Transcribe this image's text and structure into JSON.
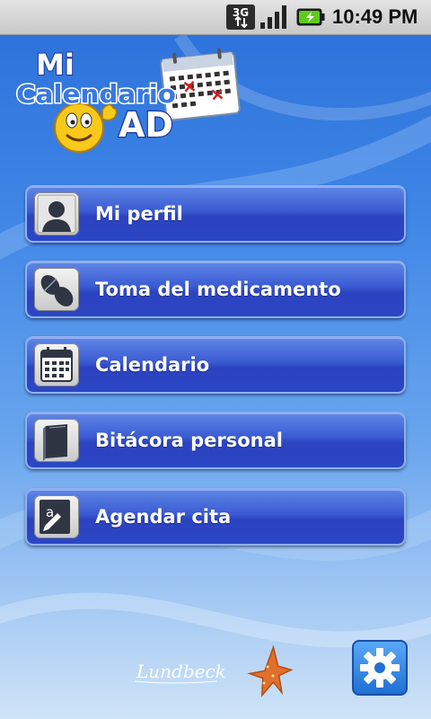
{
  "status_bar": {
    "network_label": "3G",
    "time": "10:49 PM",
    "icons": [
      "3g-data-icon",
      "signal-strength-icon",
      "battery-charging-icon"
    ]
  },
  "logo": {
    "line1": "Mi",
    "line2": "Calendario",
    "line3": "AD"
  },
  "menu": [
    {
      "label": "Mi perfil",
      "icon": "profile-silhouette-icon"
    },
    {
      "label": "Toma del medicamento",
      "icon": "pills-icon"
    },
    {
      "label": "Calendario",
      "icon": "calendar-icon"
    },
    {
      "label": "Bitácora personal",
      "icon": "notebook-icon"
    },
    {
      "label": "Agendar cita",
      "icon": "appointment-pen-icon"
    }
  ],
  "footer": {
    "brand": "Lundbeck",
    "settings_icon": "gear-icon"
  },
  "colors": {
    "button_blue": "#2b46c5",
    "button_border": "#8db0f2",
    "background_top": "#2a6fd9",
    "background_bottom": "#cfe3f7",
    "starfish": "#e0702a"
  }
}
